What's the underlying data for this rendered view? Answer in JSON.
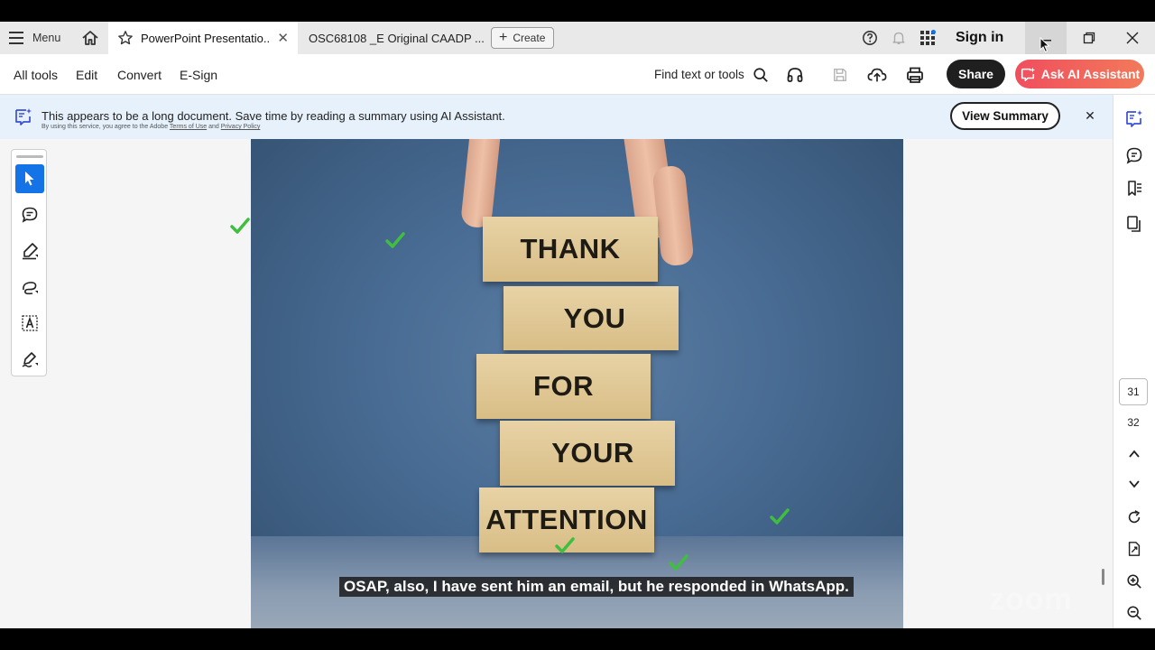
{
  "tabs": {
    "menu_label": "Menu",
    "active_title": "PowerPoint Presentatio...",
    "inactive_title": "OSC68108 _E Original CAADP ...",
    "create_label": "Create",
    "sign_in": "Sign in"
  },
  "toolbar": {
    "all_tools": "All tools",
    "edit": "Edit",
    "convert": "Convert",
    "esign": "E-Sign",
    "find": "Find text or tools",
    "share": "Share",
    "ask_ai": "Ask AI Assistant"
  },
  "banner": {
    "message": "This appears to be a long document. Save time by reading a summary using AI Assistant.",
    "legal_prefix": "By using this service, you agree to the Adobe",
    "terms": "Terms of Use",
    "and": "and",
    "privacy": "Privacy Policy",
    "view_summary": "View Summary"
  },
  "slide": {
    "blocks": [
      "THANK",
      "YOU",
      "FOR",
      "YOUR",
      "ATTENTION"
    ]
  },
  "caption": "OSAP, also, I have sent him an email, but he responded in WhatsApp.",
  "pages": {
    "current": "31",
    "total": "32"
  },
  "watermark": "zoom",
  "colors": {
    "accent_blue": "#1473e6",
    "ai_gradient_start": "#f04e5e",
    "share_bg": "#1f1f1f",
    "banner_bg": "#e6f1fb",
    "check_green": "#3fbf3f"
  },
  "icons": {
    "menu": "hamburger-icon",
    "home": "home-icon",
    "star": "star-icon",
    "help": "help-icon",
    "bell": "bell-icon",
    "apps": "apps-grid-icon",
    "search": "search-icon",
    "read_aloud": "headphones-icon",
    "save": "save-icon",
    "upload": "cloud-upload-icon",
    "print": "print-icon"
  }
}
